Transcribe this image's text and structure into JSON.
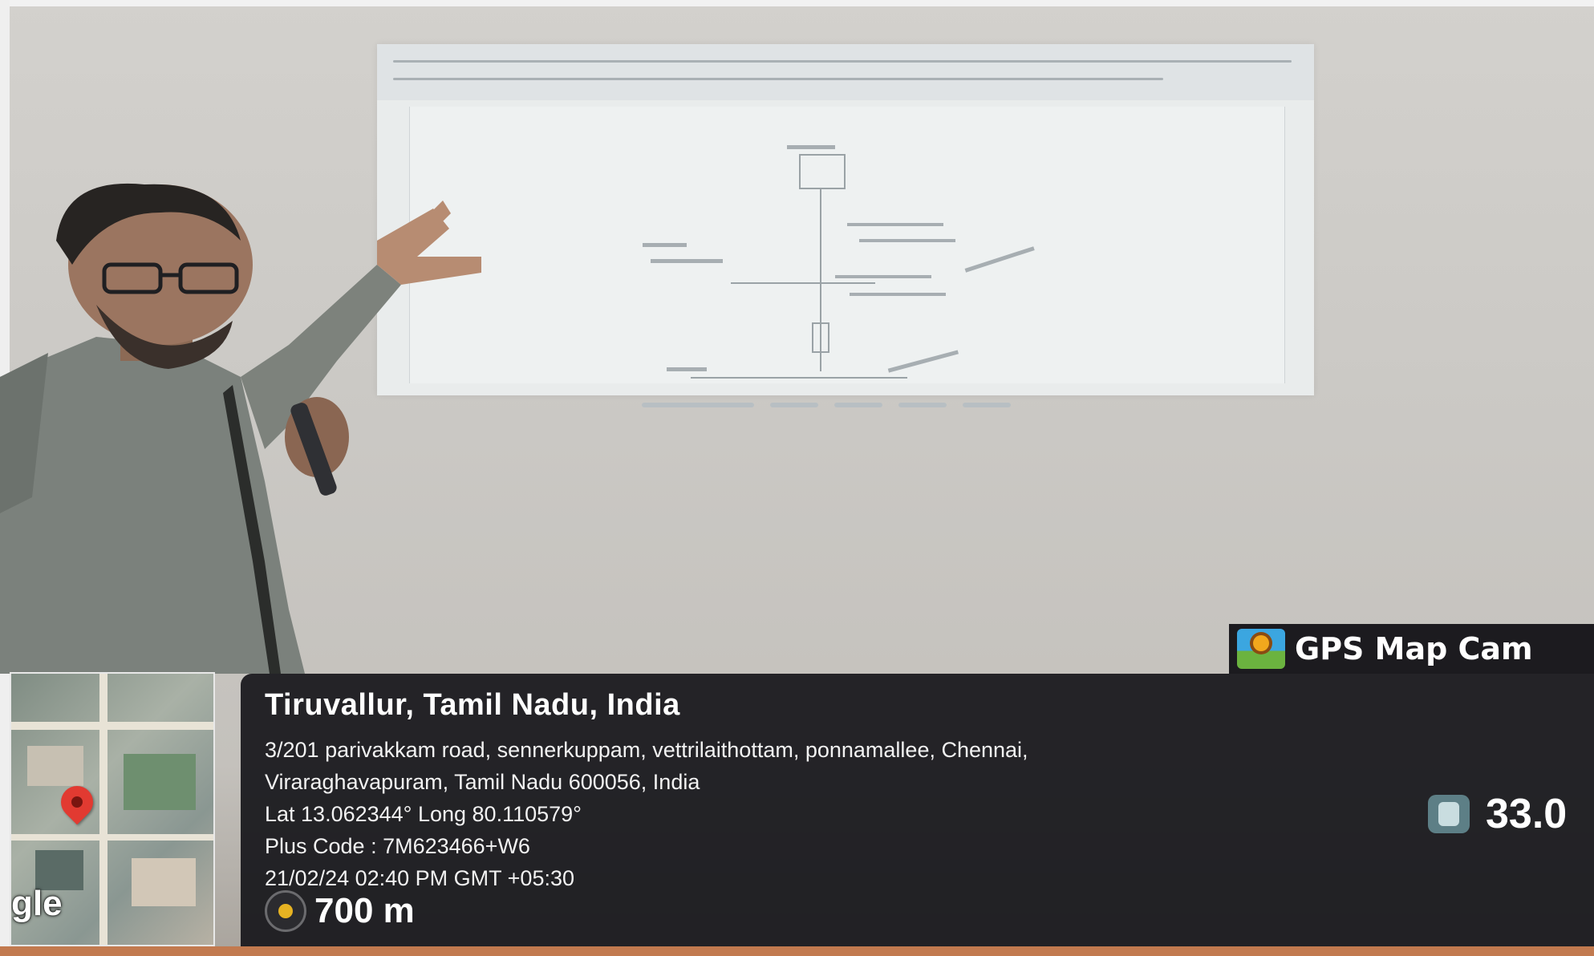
{
  "overlay": {
    "app_name": "GPS Map Cam",
    "location_title": "Tiruvallur, Tamil Nadu, India",
    "address_line_1": "3/201 parivakkam road, sennerkuppam, vettrilaithottam, ponnamallee, Chennai,",
    "address_line_2": "Viraraghavapuram, Tamil Nadu 600056, India",
    "lat_long": "Lat 13.062344° Long 80.110579°",
    "plus_code": "Plus Code : 7M623466+W6",
    "datetime": "21/02/24 02:40 PM GMT +05:30",
    "distance": "700 m",
    "temperature": "33.0",
    "map_brand": "gle",
    "icons": {
      "app_logo": "gps-map-cam-logo-icon",
      "distance": "compass-dot-icon",
      "temperature": "thermometer-icon",
      "map_pin": "map-pin-icon"
    }
  },
  "colors": {
    "overlay_bg": "#16161a",
    "brand_bg": "#1c1b1f",
    "pin": "#e23a31",
    "distance_dot": "#e7b322"
  }
}
